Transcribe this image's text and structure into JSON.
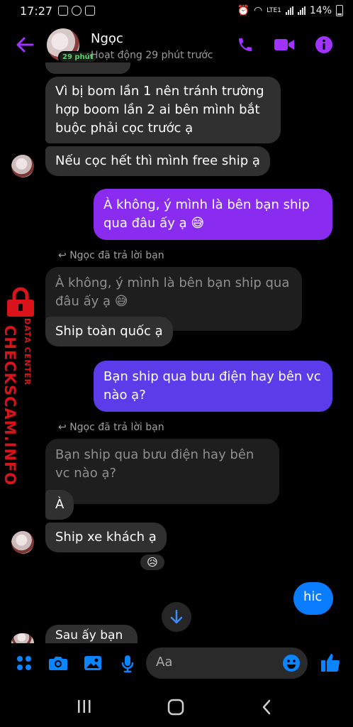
{
  "status_bar": {
    "time": "17:27",
    "network": "LTE1",
    "battery": "14%"
  },
  "header": {
    "contact_name": "Ngọc",
    "active_badge": "29 phút",
    "activity_status": "Hoạt động 29 phút trước"
  },
  "messages": {
    "m1": "Vì bị bom lần 1 nên tránh trường hợp boom  lần 2 ai bên mình bắt buộc phải cọc trước ạ",
    "m2": "Nếu cọc hết thì mình free ship ạ",
    "m3": "À không, ý mình là bên bạn ship qua đâu ấy ạ 😅",
    "reply1_label": "Ngọc đã trả lời bạn",
    "quote1": "À không, ý mình là bên bạn ship qua đâu ấy ạ 😅",
    "m4": "Ship toàn quốc ạ",
    "m5": "Bạn ship qua bưu điện hay bên vc nào ạ?",
    "reply2_label": "Ngọc đã trả lời bạn",
    "quote2": "Bạn ship qua bưu điện hay bên vc nào ạ?",
    "m6": "À",
    "m7": "Ship xe khách ạ",
    "m7_reaction": "😥",
    "m8": "hic",
    "m9_partial": "Sau ấy bạn"
  },
  "watermark": {
    "main": "CHECKSCAM.INFO",
    "sub": "DATA CENTER"
  },
  "composer": {
    "placeholder": "Aa"
  },
  "colors": {
    "accent": "#a033ff",
    "outgoing_gradient_top": "#8a2cf0",
    "outgoing_gradient_bottom": "#5a3de8",
    "outgoing_blue": "#0a7cff",
    "incoming": "#303030",
    "watermark_red": "#d8141a"
  }
}
